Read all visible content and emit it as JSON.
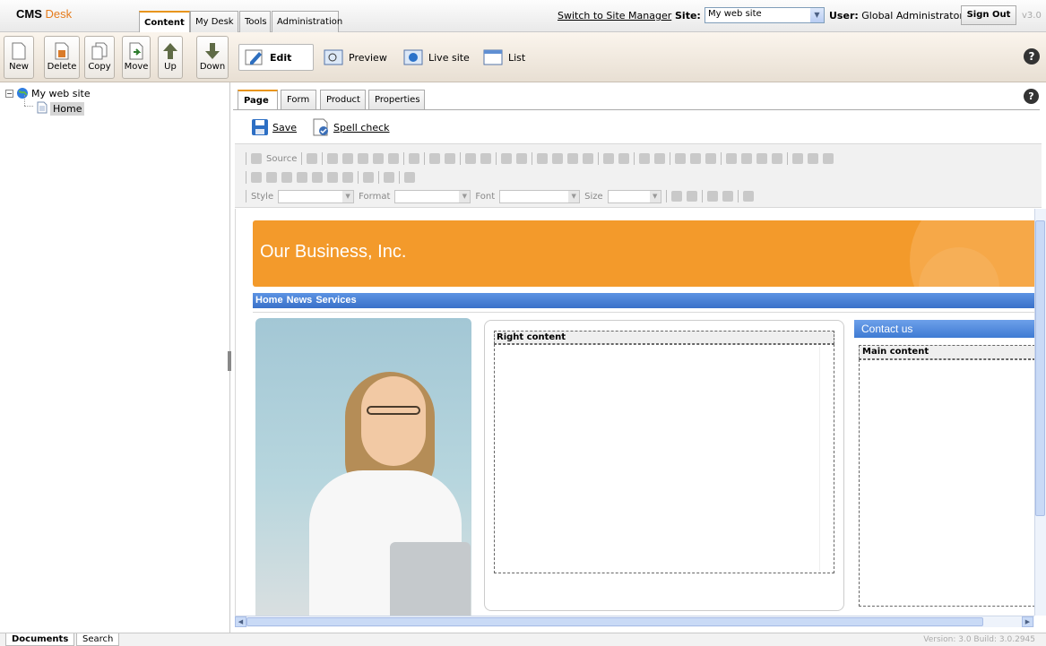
{
  "app": {
    "brand_cms": "CMS",
    "brand_desk": "Desk"
  },
  "main_tabs": [
    {
      "label": "Content",
      "active": true
    },
    {
      "label": "My Desk"
    },
    {
      "label": "Tools"
    },
    {
      "label": "Administration"
    }
  ],
  "header": {
    "switch_link": "Switch to Site Manager",
    "site_label": "Site:",
    "site_value": "My web site",
    "user_label": "User:",
    "user_value": "Global Administrator",
    "sign_out": "Sign Out",
    "version_short": "v3.0"
  },
  "doc_actions": [
    {
      "label": "New",
      "icon": "new-document-icon"
    },
    {
      "label": "Delete",
      "icon": "delete-document-icon"
    },
    {
      "label": "Copy",
      "icon": "copy-document-icon"
    },
    {
      "label": "Move",
      "icon": "move-document-icon"
    },
    {
      "label": "Up",
      "icon": "arrow-up-icon"
    },
    {
      "label": "Down",
      "icon": "arrow-down-icon"
    }
  ],
  "modes": [
    {
      "label": "Edit",
      "active": true,
      "icon": "edit-icon"
    },
    {
      "label": "Preview",
      "icon": "preview-icon"
    },
    {
      "label": "Live site",
      "icon": "live-site-icon"
    },
    {
      "label": "List",
      "icon": "list-icon"
    }
  ],
  "tree": {
    "root": "My web site",
    "child": "Home"
  },
  "page_tabs": [
    {
      "label": "Page",
      "active": true
    },
    {
      "label": "Form"
    },
    {
      "label": "Product"
    },
    {
      "label": "Properties"
    }
  ],
  "page_actions": {
    "save": "Save",
    "spell_check": "Spell check"
  },
  "editor_toolbar": {
    "source": "Source",
    "style_label": "Style",
    "format_label": "Format",
    "font_label": "Font",
    "size_label": "Size"
  },
  "preview": {
    "banner_title": "Our Business, Inc.",
    "nav_items": [
      "Home",
      "News",
      "Services"
    ],
    "right_content_label": "Right content",
    "contact_header": "Contact us",
    "main_content_label": "Main content"
  },
  "bottom_tabs": [
    {
      "label": "Documents",
      "active": true
    },
    {
      "label": "Search"
    }
  ],
  "footer": {
    "build": "Version: 3.0 Build: 3.0.2945"
  },
  "colors": {
    "accent_orange": "#e57b1c",
    "banner_orange": "#f39a2b",
    "nav_blue": "#3a71c9"
  }
}
